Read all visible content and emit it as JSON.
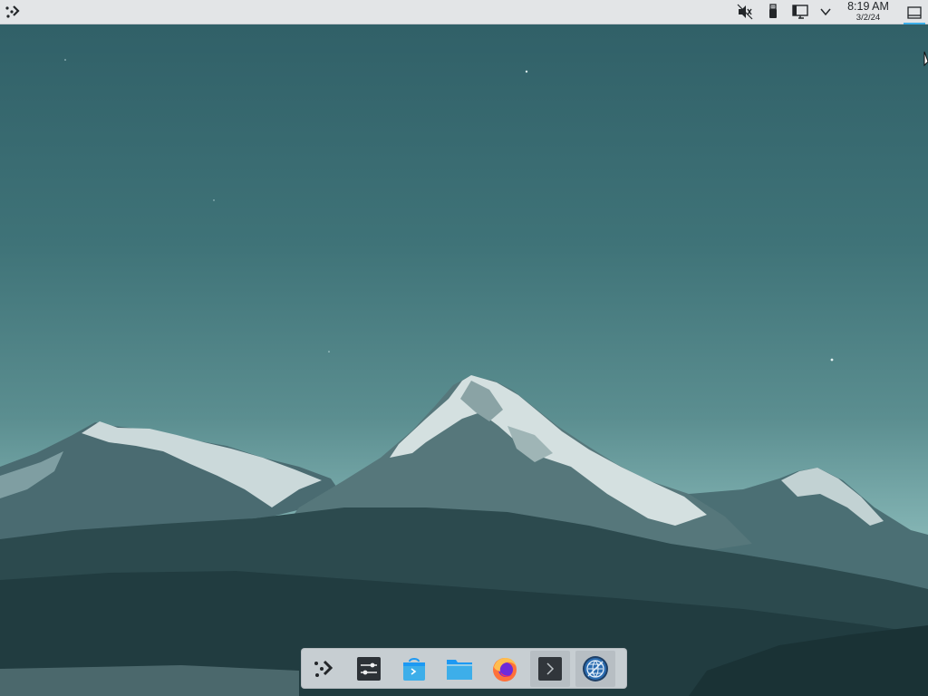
{
  "clock": {
    "time": "8:19 AM",
    "date": "3/2/24"
  },
  "top_panel": {
    "launcher_icon": "app-launcher-icon",
    "tray": [
      {
        "icon": "volume-muted-icon"
      },
      {
        "icon": "removable-device-icon"
      },
      {
        "icon": "network-wired-icon"
      },
      {
        "icon": "expand-tray-icon"
      }
    ],
    "show_desktop_icon": "show-desktop-icon",
    "accent_color": "#3daee9"
  },
  "dock": {
    "items": [
      {
        "icon": "app-launcher-icon"
      },
      {
        "icon": "system-settings-icon"
      },
      {
        "icon": "discover-store-icon"
      },
      {
        "icon": "file-manager-icon"
      },
      {
        "icon": "firefox-icon"
      },
      {
        "icon": "terminal-icon",
        "active": true
      },
      {
        "icon": "network-browser-icon",
        "active": true
      }
    ]
  },
  "colors": {
    "panel_bg": "#e3e5e7",
    "sky_top": "#2f5e66",
    "sky_horizon": "#8fbdba",
    "mountain_dark": "#1f3b3e",
    "snow": "#d8e3e3"
  }
}
